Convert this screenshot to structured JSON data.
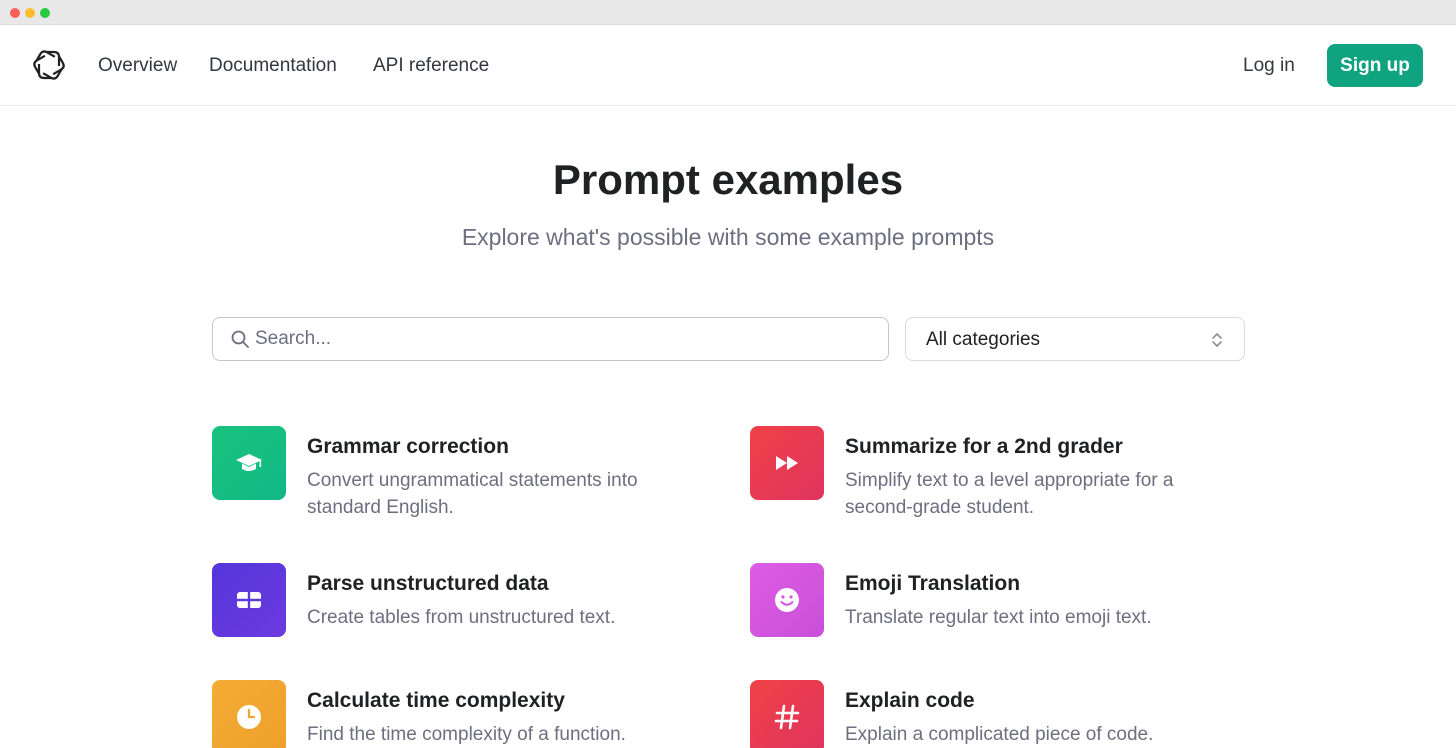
{
  "nav": {
    "links": [
      "Overview",
      "Documentation",
      "API reference"
    ],
    "login": "Log in",
    "signup": "Sign up"
  },
  "hero": {
    "title": "Prompt examples",
    "subtitle": "Explore what's possible with some example prompts"
  },
  "search": {
    "placeholder": "Search..."
  },
  "category_select": {
    "value": "All categories"
  },
  "colors": {
    "brand": "#10a37f",
    "grammar": "#19c37d",
    "summarize": "#ef4146",
    "parse": "#5436da",
    "emoji": "#dd5ce5",
    "time": "#f4ac36",
    "explain": "#ef4146"
  },
  "examples": [
    {
      "title": "Grammar correction",
      "description": "Convert ungrammatical statements into standard English.",
      "icon": "graduation-cap-icon"
    },
    {
      "title": "Summarize for a 2nd grader",
      "description": "Simplify text to a level appropriate for a second-grade student.",
      "icon": "fast-forward-icon"
    },
    {
      "title": "Parse unstructured data",
      "description": "Create tables from unstructured text.",
      "icon": "table-icon"
    },
    {
      "title": "Emoji Translation",
      "description": "Translate regular text into emoji text.",
      "icon": "smiley-icon"
    },
    {
      "title": "Calculate time complexity",
      "description": "Find the time complexity of a function.",
      "icon": "clock-icon"
    },
    {
      "title": "Explain code",
      "description": "Explain a complicated piece of code.",
      "icon": "hashtag-icon"
    }
  ]
}
